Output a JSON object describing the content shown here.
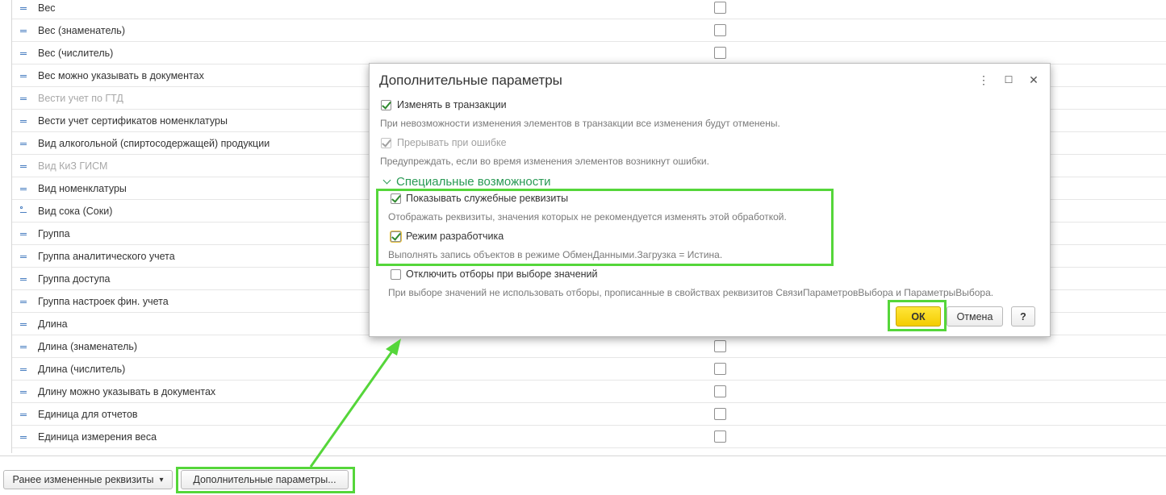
{
  "list": {
    "rows": [
      {
        "label": "Вес",
        "disabled": false,
        "icon": "attribute-icon"
      },
      {
        "label": "Вес (знаменатель)",
        "disabled": false,
        "icon": "attribute-icon"
      },
      {
        "label": "Вес (числитель)",
        "disabled": false,
        "icon": "attribute-icon"
      },
      {
        "label": "Вес можно указывать в документах",
        "disabled": false,
        "icon": "attribute-icon"
      },
      {
        "label": "Вести учет по ГТД",
        "disabled": true,
        "icon": "attribute-icon"
      },
      {
        "label": "Вести учет сертификатов номенклатуры",
        "disabled": false,
        "icon": "attribute-icon"
      },
      {
        "label": "Вид алкогольной (спиртосодержащей) продукции",
        "disabled": false,
        "icon": "attribute-icon"
      },
      {
        "label": "Вид КиЗ ГИСМ",
        "disabled": true,
        "icon": "attribute-icon"
      },
      {
        "label": "Вид номенклатуры",
        "disabled": false,
        "icon": "attribute-icon"
      },
      {
        "label": "Вид сока (Соки)",
        "disabled": false,
        "icon": "extra-attribute-icon"
      },
      {
        "label": "Группа",
        "disabled": false,
        "icon": "attribute-icon"
      },
      {
        "label": "Группа аналитического учета",
        "disabled": false,
        "icon": "attribute-icon"
      },
      {
        "label": "Группа доступа",
        "disabled": false,
        "icon": "attribute-icon"
      },
      {
        "label": "Группа настроек фин. учета",
        "disabled": false,
        "icon": "attribute-icon"
      },
      {
        "label": "Длина",
        "disabled": false,
        "icon": "attribute-icon"
      },
      {
        "label": "Длина (знаменатель)",
        "disabled": false,
        "icon": "attribute-icon"
      },
      {
        "label": "Длина (числитель)",
        "disabled": false,
        "icon": "attribute-icon"
      },
      {
        "label": "Длину можно указывать в документах",
        "disabled": false,
        "icon": "attribute-icon"
      },
      {
        "label": "Единица для отчетов",
        "disabled": false,
        "icon": "attribute-icon"
      },
      {
        "label": "Единица измерения веса",
        "disabled": false,
        "icon": "attribute-icon"
      }
    ]
  },
  "bottom": {
    "changed_button": "Ранее измененные реквизиты",
    "changed_dropdown_glyph": "▾",
    "params_button": "Дополнительные параметры..."
  },
  "dialog": {
    "title": "Дополнительные параметры",
    "more_glyph": "⋮",
    "maximize_glyph": "☐",
    "close_glyph": "✕",
    "opt_transaction_label": "Изменять в транзакции",
    "opt_transaction_hint": "При невозможности изменения элементов в транзакции все изменения будут отменены.",
    "opt_abort_label": "Прерывать при ошибке",
    "opt_abort_hint": "Предупреждать, если во время изменения элементов возникнут ошибки.",
    "section_title": "Специальные возможности",
    "opt_service_label": "Показывать служебные реквизиты",
    "opt_service_hint": "Отображать реквизиты, значения которых не рекомендуется изменять этой обработкой.",
    "opt_dev_label": "Режим разработчика",
    "opt_dev_hint": "Выполнять запись объектов в режиме ОбменДанными.Загрузка = Истина.",
    "opt_filters_label": "Отключить отборы при выборе значений",
    "opt_filters_hint": "При выборе значений не использовать отборы, прописанные в свойствах реквизитов СвязиПараметровВыбора и ПараметрыВыбора.",
    "ok_label": "ОК",
    "cancel_label": "Отмена",
    "help_label": "?"
  },
  "colors": {
    "highlight": "#55d63a",
    "ok_button": "#f4cc00",
    "section_title": "#2a9a55",
    "checkmark": "#2f8a2f"
  }
}
